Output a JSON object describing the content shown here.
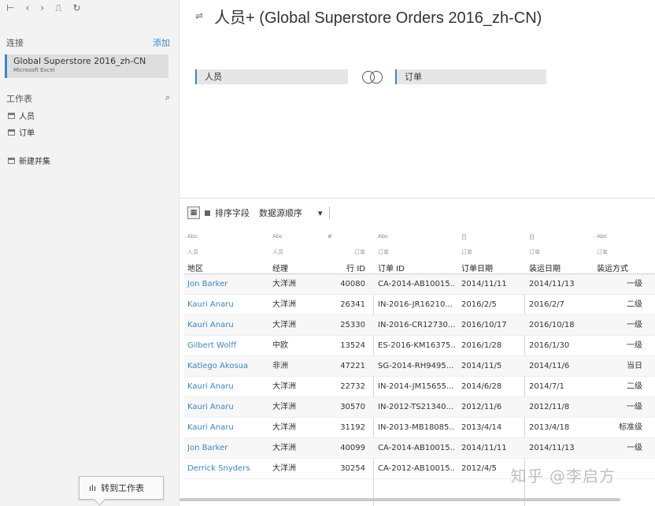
{
  "toolbar": {
    "icons": [
      {
        "name": "home-icon",
        "glyph": "⊢"
      },
      {
        "name": "back-icon",
        "glyph": "‹"
      },
      {
        "name": "forward-icon",
        "glyph": "›"
      },
      {
        "name": "chart-icon",
        "glyph": "⎍"
      },
      {
        "name": "refresh-icon",
        "glyph": "↻"
      }
    ]
  },
  "sidebar": {
    "connections_label": "连接",
    "add_label": "添加",
    "connection": {
      "name": "Global Superstore 2016_zh-CN",
      "type": "Microsoft Excel"
    },
    "sheets_label": "工作表",
    "sheets": [
      {
        "label": "人员"
      },
      {
        "label": "订单"
      }
    ],
    "new_union_label": "新建并集"
  },
  "canvas": {
    "title": "人员+ (Global Superstore Orders 2016_zh-CN)",
    "left_table": "人员",
    "right_table": "订单"
  },
  "grid": {
    "toolbar_label": "排序字段",
    "sort_value": "数据源顺序",
    "columns": [
      {
        "type": "Abc",
        "table": "人员",
        "name": "地区"
      },
      {
        "type": "Abc",
        "table": "人员",
        "name": "经理"
      },
      {
        "type": "#",
        "table": "订单",
        "name": "行 ID"
      },
      {
        "type": "Abc",
        "table": "订单",
        "name": "订单 ID"
      },
      {
        "type": "日",
        "table": "订单",
        "name": "订单日期"
      },
      {
        "type": "日",
        "table": "订单",
        "name": "装运日期"
      },
      {
        "type": "Abc",
        "table": "订单",
        "name": "装运方式"
      }
    ],
    "rows": [
      [
        "Jon Barker",
        "大洋洲",
        "40080",
        "CA-2014-AB10015...",
        "2014/11/11",
        "2014/11/13",
        "一级"
      ],
      [
        "Kauri Anaru",
        "大洋洲",
        "26341",
        "IN-2016-JR16210...",
        "2016/2/5",
        "2016/2/7",
        "二级"
      ],
      [
        "Kauri Anaru",
        "大洋洲",
        "25330",
        "IN-2016-CR12730...",
        "2016/10/17",
        "2016/10/18",
        "一级"
      ],
      [
        "Gilbert Wolff",
        "中欧",
        "13524",
        "ES-2016-KM16375...",
        "2016/1/28",
        "2016/1/30",
        "一级"
      ],
      [
        "Katlego Akosua",
        "非洲",
        "47221",
        "SG-2014-RH9495...",
        "2014/11/5",
        "2014/11/6",
        "当日"
      ],
      [
        "Kauri Anaru",
        "大洋洲",
        "22732",
        "IN-2014-JM15655...",
        "2014/6/28",
        "2014/7/1",
        "二级"
      ],
      [
        "Kauri Anaru",
        "大洋洲",
        "30570",
        "IN-2012-TS21340...",
        "2012/11/6",
        "2012/11/8",
        "一级"
      ],
      [
        "Kauri Anaru",
        "大洋洲",
        "31192",
        "IN-2013-MB18085...",
        "2013/4/14",
        "2013/4/18",
        "标准级"
      ],
      [
        "Jon Barker",
        "大洋洲",
        "40099",
        "CA-2014-AB10015...",
        "2014/11/11",
        "2014/11/13",
        "一级"
      ],
      [
        "Derrick Snyders",
        "大洋洲",
        "30254",
        "CA-2012-AB10015...",
        "2012/4/5",
        "",
        ""
      ]
    ]
  },
  "sheet_tab": {
    "label": "转到工作表"
  },
  "watermark": "知乎 @李启方"
}
